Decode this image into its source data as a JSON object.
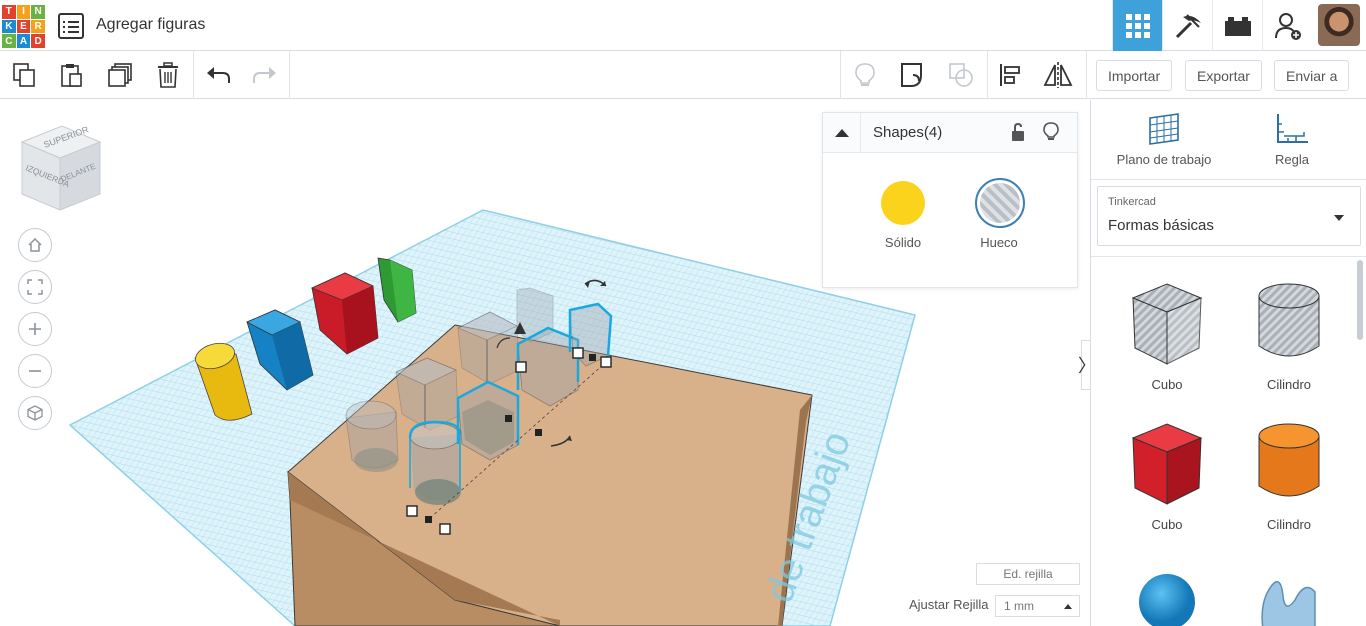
{
  "app": {
    "logo_letters": [
      "T",
      "I",
      "N",
      "K",
      "E",
      "R",
      "C",
      "A",
      "D"
    ],
    "title": "Agregar figuras"
  },
  "topbar_right": {
    "icons": [
      "grid-view-icon",
      "pickaxe-icon",
      "bricks-icon",
      "add-user-icon",
      "user-avatar"
    ],
    "active_color": "#3fa1d9"
  },
  "toolbar": {
    "import_label": "Importar",
    "export_label": "Exportar",
    "send_label": "Enviar a"
  },
  "viewcube": {
    "top": "SUPERIOR",
    "left": "IZQUIERDA",
    "front": "DELANTE"
  },
  "inspector": {
    "title": "Shapes(4)",
    "solid_label": "Sólido",
    "hole_label": "Hueco",
    "solid_color": "#fcd31c"
  },
  "workplane": {
    "watermark": "de trabajo",
    "edit_grid_label": "Ed. rejilla",
    "snap_label": "Ajustar Rejilla",
    "snap_value": "1 mm"
  },
  "right_panel": {
    "workplane_label": "Plano de trabajo",
    "ruler_label": "Regla",
    "library_provider": "Tinkercad",
    "library_name": "Formas básicas",
    "shapes": [
      {
        "label": "Cubo",
        "icon": "hole-cube-icon"
      },
      {
        "label": "Cilindro",
        "icon": "hole-cylinder-icon"
      },
      {
        "label": "Cubo",
        "icon": "red-cube-icon"
      },
      {
        "label": "Cilindro",
        "icon": "orange-cylinder-icon"
      },
      {
        "label": "",
        "icon": "sphere-icon"
      },
      {
        "label": "",
        "icon": "scribble-icon"
      }
    ]
  },
  "colors": {
    "box_color": "#dcb48c",
    "grid_color": "#aee0f0",
    "selection_color": "#19a9e0",
    "yellow": "#f2cc1d",
    "blue": "#1c8fd0",
    "red": "#d6202c",
    "green": "#3aa63a"
  }
}
